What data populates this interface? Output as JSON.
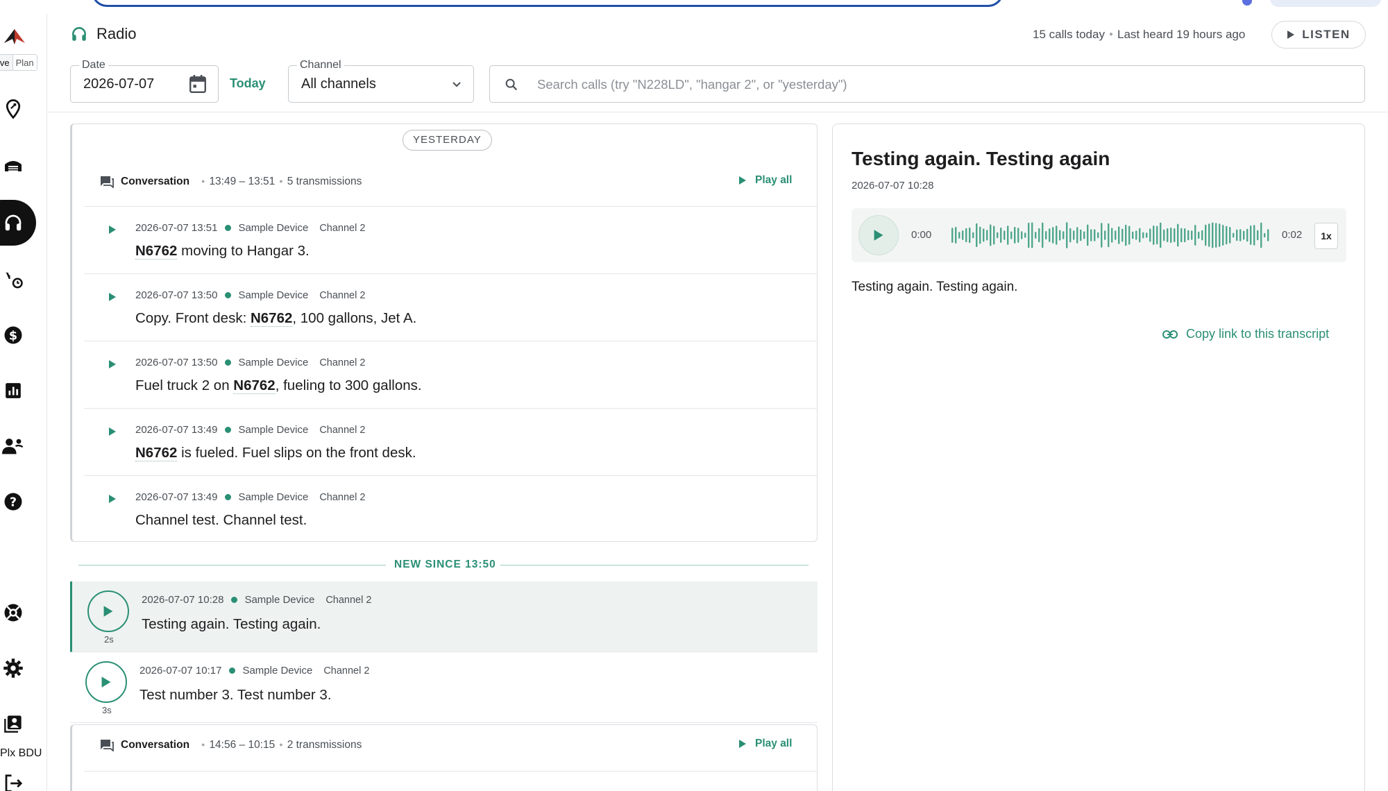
{
  "colors": {
    "accent": "#2a8f74",
    "text": "#1d1d1f",
    "muted": "#4a4f55"
  },
  "sidebar": {
    "mode_toggle": {
      "live": "ive",
      "plan": "Plan"
    },
    "icons": [
      "location-pin-icon",
      "hangar-icon",
      "headset-icon",
      "flight-timer-icon",
      "dollar-icon",
      "bar-chart-icon",
      "people-icon",
      "help-icon",
      "lifebuoy-icon",
      "gear-icon",
      "account-icon",
      "logout-icon"
    ],
    "account_label": "Plx BDU"
  },
  "header": {
    "title": "Radio",
    "calls_today": "15 calls today",
    "last_heard": "Last heard 19 hours ago",
    "listen_label": "LISTEN"
  },
  "filters": {
    "date_label": "Date",
    "date_value": "2026-07-07",
    "today_label": "Today",
    "channel_label": "Channel",
    "channel_value": "All channels",
    "search_placeholder": "Search calls (try \"N228LD\", \"hangar 2\", or \"yesterday\")"
  },
  "list": {
    "day_pill": "YESTERDAY",
    "conversation1": {
      "label": "Conversation",
      "time_range": "13:49 – 13:51",
      "count": "5 transmissions",
      "play_all": "Play all",
      "transmissions": [
        {
          "time": "2026-07-07 13:51",
          "device": "Sample Device",
          "channel": "Channel 2",
          "pre": "",
          "tail": "N6762",
          "post": " moving to Hangar 3."
        },
        {
          "time": "2026-07-07 13:50",
          "device": "Sample Device",
          "channel": "Channel 2",
          "pre": "Copy. Front desk: ",
          "tail": "N6762",
          "post": ", 100 gallons, Jet A."
        },
        {
          "time": "2026-07-07 13:50",
          "device": "Sample Device",
          "channel": "Channel 2",
          "pre": "Fuel truck 2 on ",
          "tail": "N6762",
          "post": ", fueling to 300 gallons."
        },
        {
          "time": "2026-07-07 13:49",
          "device": "Sample Device",
          "channel": "Channel 2",
          "pre": "",
          "tail": "N6762",
          "post": " is fueled. Fuel slips on the front desk."
        },
        {
          "time": "2026-07-07 13:49",
          "device": "Sample Device",
          "channel": "Channel 2",
          "pre": "Channel test. Channel test.",
          "tail": "",
          "post": ""
        }
      ]
    },
    "new_since": "NEW SINCE 13:50",
    "recent": [
      {
        "time": "2026-07-07 10:28",
        "device": "Sample Device",
        "channel": "Channel 2",
        "text": "Testing again. Testing again.",
        "duration": "2s"
      },
      {
        "time": "2026-07-07 10:17",
        "device": "Sample Device",
        "channel": "Channel 2",
        "text": "Test number 3. Test number 3.",
        "duration": "3s"
      }
    ],
    "conversation2": {
      "label": "Conversation",
      "time_range": "14:56 – 10:15",
      "count": "2 transmissions",
      "play_all": "Play all"
    }
  },
  "detail": {
    "title": "Testing again. Testing again",
    "date": "2026-07-07 10:28",
    "player": {
      "current": "0:00",
      "total": "0:02",
      "speed": "1x",
      "progress": 0
    },
    "transcript": "Testing again. Testing again.",
    "copy_link": "Copy link to this transcript"
  }
}
